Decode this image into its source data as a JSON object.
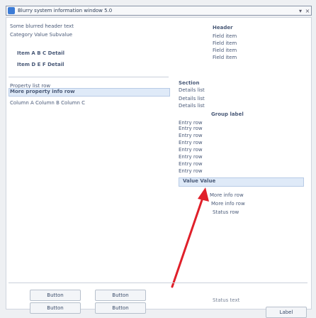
{
  "window": {
    "title": "Blurry system information window 5.0"
  },
  "left_block": {
    "line1": "Some blurred header text",
    "line2": "Category   Value   Subvalue",
    "line3": "Item A    B    C    Detail",
    "line4": "Item D    E    F    Detail",
    "line5": "Property list row",
    "line6": "More property info row",
    "line7": "Column A   Column B   Column C"
  },
  "right_block": {
    "line1": "Header",
    "line2": "Field item",
    "line3": "Field item",
    "line4": "Field item",
    "line5": "Field item",
    "line6": "Section",
    "line7": "Details list",
    "line8": "Details list",
    "line9": "Details list",
    "line10": "Group label",
    "line11": "Entry row",
    "line12": "Entry row",
    "line13": "Entry row",
    "line14": "Entry row",
    "line15": "Entry row",
    "line16": "Entry row",
    "line17": "Entry row",
    "line18": "Entry row",
    "line19": "Value  Value",
    "line20": "More info row",
    "line21": "More info row",
    "line22": "Status row"
  },
  "bottom": {
    "btn1": "Button",
    "btn2": "Button",
    "btn3": "Button",
    "btn4": "Button",
    "status_text": "Status text",
    "small_label": "Label"
  }
}
